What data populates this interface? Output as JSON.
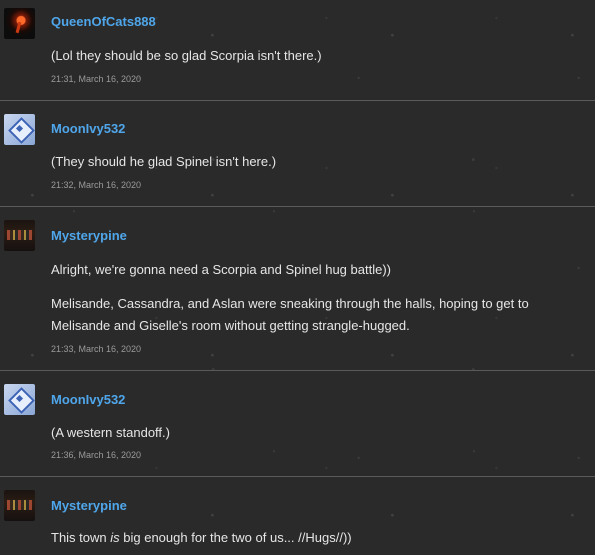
{
  "comments": [
    {
      "username": "QueenOfCats888",
      "avatar_icon": "cat-avatar-icon",
      "messages": [
        "(Lol they should be so glad Scorpia isn't there.)"
      ],
      "timestamp": "21:31, March 16, 2020"
    },
    {
      "username": "MoonIvy532",
      "avatar_icon": "diamond-avatar-icon",
      "messages": [
        "(They should he glad Spinel isn't here.)"
      ],
      "timestamp": "21:32, March 16, 2020"
    },
    {
      "username": "Mysterypine",
      "avatar_icon": "pine-avatar-icon",
      "messages": [
        "Alright, we're gonna need a Scorpia and Spinel hug battle))",
        "Melisande, Cassandra, and Aslan were sneaking through the halls, hoping to get to",
        "Melisande and Giselle's room without getting strangle-hugged."
      ],
      "timestamp": "21:33, March 16, 2020"
    },
    {
      "username": "MoonIvy532",
      "avatar_icon": "diamond-avatar-icon",
      "messages": [
        "(A western standoff.)"
      ],
      "timestamp": "21:36, March 16, 2020"
    },
    {
      "username": "Mysterypine",
      "avatar_icon": "pine-avatar-icon",
      "messages": [
        "This town ",
        "is",
        " big enough for the two of us... //Hugs//))"
      ],
      "timestamp": ""
    }
  ],
  "colors": {
    "username": "#4fa6ea",
    "background": "#2a2a2a",
    "divider": "#5a5a5a"
  }
}
